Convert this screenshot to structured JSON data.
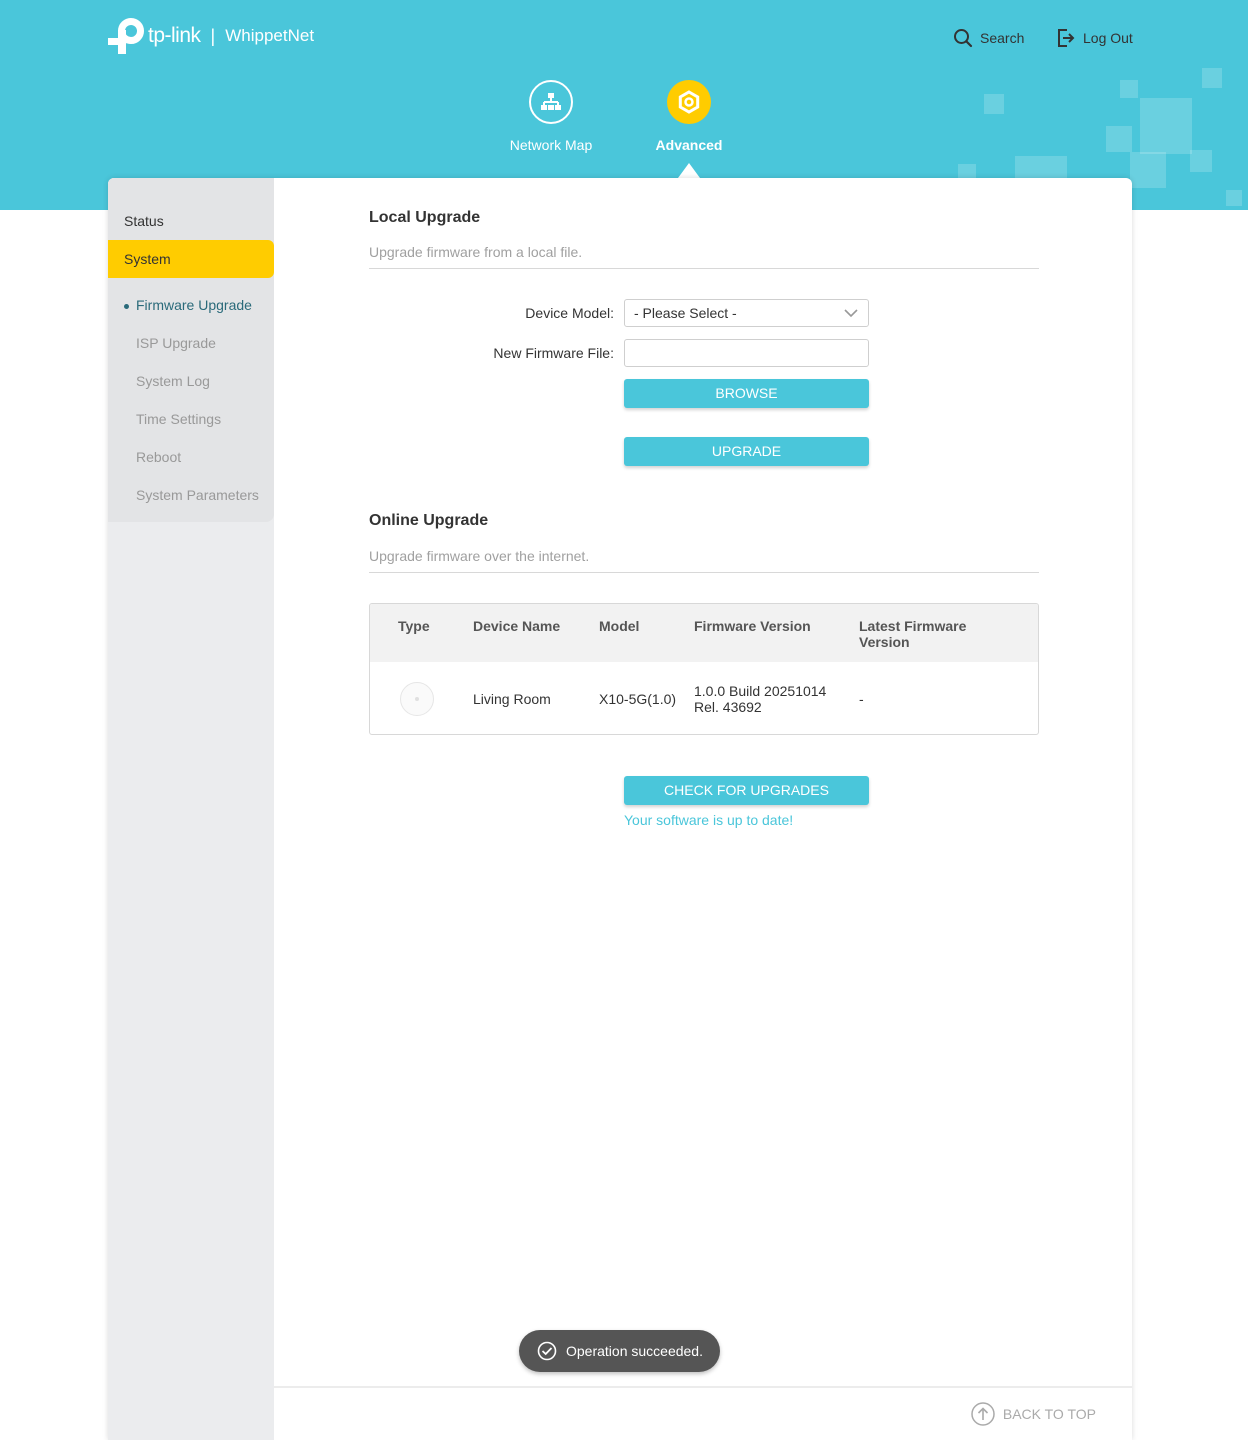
{
  "header": {
    "brand": "tp-link",
    "separator": "|",
    "network_name": "WhippetNet",
    "search_label": "Search",
    "logout_label": "Log Out"
  },
  "nav": {
    "network_map_label": "Network Map",
    "advanced_label": "Advanced",
    "active": "advanced"
  },
  "sidebar": {
    "items": [
      {
        "label": "Status"
      },
      {
        "label": "System",
        "selected": true
      }
    ],
    "subitems": [
      {
        "label": "Firmware Upgrade",
        "active": true
      },
      {
        "label": "ISP Upgrade"
      },
      {
        "label": "System Log"
      },
      {
        "label": "Time Settings"
      },
      {
        "label": "Reboot"
      },
      {
        "label": "System Parameters"
      }
    ]
  },
  "local_upgrade": {
    "title": "Local Upgrade",
    "description": "Upgrade firmware from a local file.",
    "device_model_label": "Device Model:",
    "device_model_value": "- Please Select -",
    "firmware_file_label": "New Firmware File:",
    "firmware_file_value": "",
    "browse_label": "BROWSE",
    "upgrade_label": "UPGRADE"
  },
  "online_upgrade": {
    "title": "Online Upgrade",
    "description": "Upgrade firmware over the internet.",
    "columns": [
      "Type",
      "Device Name",
      "Model",
      "Firmware Version",
      "Latest Firmware Version"
    ],
    "rows": [
      {
        "type_icon": "device-icon",
        "device_name": "Living Room",
        "model": "X10-5G(1.0)",
        "firmware_version_line1": "1.0.0 Build 20251014",
        "firmware_version_line2": "Rel. 43692",
        "latest_firmware_version": "-"
      }
    ],
    "check_label": "CHECK FOR UPGRADES",
    "status_message": "Your software is up to date!"
  },
  "toast": {
    "message": "Operation succeeded."
  },
  "footer": {
    "back_to_top_label": "BACK TO TOP"
  },
  "colors": {
    "accent": "#4ac6da",
    "highlight": "#ffcc00",
    "toast_bg": "#555555"
  }
}
